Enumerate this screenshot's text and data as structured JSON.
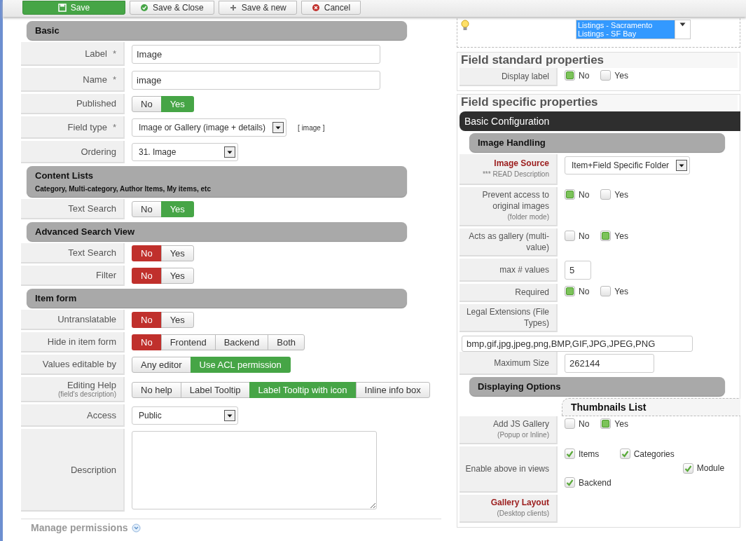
{
  "toolbar": {
    "buttons": [
      {
        "label": "Save",
        "kind": "save"
      },
      {
        "label": "Save & Close",
        "kind": "apply"
      },
      {
        "label": "Save & new",
        "kind": "new"
      },
      {
        "label": "Cancel",
        "kind": "cancel"
      }
    ]
  },
  "left": {
    "sections": [
      {
        "title": "Basic",
        "rows": [
          {
            "kind": "text",
            "label": "Label",
            "marker": "*",
            "value": "Image"
          },
          {
            "kind": "text",
            "label": "Name",
            "marker": "*",
            "value": "image"
          },
          {
            "kind": "toggle",
            "label": "Published",
            "negative": false,
            "options": [
              {
                "label": "No",
                "selected": false
              },
              {
                "label": "Yes",
                "selected": true
              }
            ]
          },
          {
            "kind": "select",
            "label": "Field type",
            "marker": "*",
            "value": "Image or Gallery (image + details)",
            "note": "[ image ]"
          },
          {
            "kind": "select",
            "label": "Ordering",
            "value": "31. Image"
          }
        ]
      },
      {
        "title": "Content Lists",
        "subtitle": "Category, Multi-category, Author Items, My items, etc",
        "rows": [
          {
            "kind": "toggle",
            "label": "Text Search",
            "negative": false,
            "options": [
              {
                "label": "No",
                "selected": false
              },
              {
                "label": "Yes",
                "selected": true
              }
            ]
          }
        ]
      },
      {
        "title": "Advanced Search View",
        "rows": [
          {
            "kind": "toggle",
            "label": "Text Search",
            "negative": true,
            "options": [
              {
                "label": "No",
                "selected": true
              },
              {
                "label": "Yes",
                "selected": false
              }
            ]
          },
          {
            "kind": "toggle",
            "label": "Filter",
            "negative": true,
            "options": [
              {
                "label": "No",
                "selected": true
              },
              {
                "label": "Yes",
                "selected": false
              }
            ]
          }
        ]
      },
      {
        "title": "Item form",
        "rows": [
          {
            "kind": "toggle",
            "label": "Untranslatable",
            "negative": true,
            "options": [
              {
                "label": "No",
                "selected": true
              },
              {
                "label": "Yes",
                "selected": false
              }
            ]
          },
          {
            "kind": "toggle",
            "label": "Hide in item form",
            "negative": true,
            "options": [
              {
                "label": "No",
                "selected": true
              },
              {
                "label": "Frontend",
                "selected": false
              },
              {
                "label": "Backend",
                "selected": false
              },
              {
                "label": "Both",
                "selected": false
              }
            ]
          },
          {
            "kind": "toggle",
            "label": "Values editable by",
            "negative": false,
            "options": [
              {
                "label": "Any editor",
                "selected": false
              },
              {
                "label": "Use ACL permission",
                "selected": true
              }
            ]
          },
          {
            "kind": "toggle",
            "label": "Editing Help",
            "sublabel": "(field's description)",
            "negative": false,
            "options": [
              {
                "label": "No help",
                "selected": false
              },
              {
                "label": "Label Tooltip",
                "selected": false
              },
              {
                "label": "Label Tooltip with icon",
                "selected": true
              },
              {
                "label": "Inline info box",
                "selected": false
              }
            ]
          },
          {
            "kind": "select",
            "label": "Access",
            "value": "Public"
          },
          {
            "kind": "textarea",
            "label": "Description"
          }
        ]
      }
    ],
    "footer": {
      "label": "Manage permissions"
    }
  },
  "right": {
    "listbox": {
      "items": [
        {
          "label": "Listings - Sacramento",
          "selected": true
        },
        {
          "label": "Listings - SF Bay",
          "selected": true
        }
      ]
    },
    "panels": [
      {
        "title": "Field standard properties",
        "rows": [
          {
            "kind": "radio",
            "label": "Display label",
            "options": [
              {
                "label": "No",
                "selected": true
              },
              {
                "label": "Yes",
                "selected": false
              }
            ]
          }
        ]
      },
      {
        "title": "Field specific properties",
        "tab": "Basic Configuration",
        "sections": [
          {
            "title": "Image Handling",
            "rows": [
              {
                "kind": "select",
                "label": "Image Source",
                "important": true,
                "sublabel": "*** READ Description",
                "value": "Item+Field Specific Folder"
              },
              {
                "kind": "radio",
                "label": "Prevent access to original images",
                "sublabel": "(folder mode)",
                "options": [
                  {
                    "label": "No",
                    "selected": true
                  },
                  {
                    "label": "Yes",
                    "selected": false
                  }
                ]
              },
              {
                "kind": "radio",
                "label": "Acts as gallery (multi-value)",
                "options": [
                  {
                    "label": "No",
                    "selected": false
                  },
                  {
                    "label": "Yes",
                    "selected": true
                  }
                ]
              },
              {
                "kind": "number",
                "label": "max # values",
                "value": "5"
              },
              {
                "kind": "radio",
                "label": "Required",
                "options": [
                  {
                    "label": "No",
                    "selected": true
                  },
                  {
                    "label": "Yes",
                    "selected": false
                  }
                ]
              },
              {
                "kind": "label",
                "label": "Legal Extensions (File Types)"
              },
              {
                "kind": "wide_text",
                "value": "bmp,gif,jpg,jpeg,png,BMP,GIF,JPG,JPEG,PNG"
              },
              {
                "kind": "text",
                "label": "Maximum Size",
                "value": "262144"
              }
            ]
          },
          {
            "title": "Displaying Options",
            "subtab": "Thumbnails List",
            "rows": [
              {
                "kind": "radio",
                "label": "Add JS Gallery",
                "sublabel": "(Popup or Inline)",
                "options": [
                  {
                    "label": "No",
                    "selected": false
                  },
                  {
                    "label": "Yes",
                    "selected": true
                  }
                ]
              },
              {
                "kind": "checks",
                "label": "Enable above in views",
                "options": [
                  {
                    "label": "Items",
                    "checked": true
                  },
                  {
                    "label": "Categories",
                    "checked": true
                  },
                  {
                    "label": "Module",
                    "checked": true
                  },
                  {
                    "label": "Backend",
                    "checked": true
                  }
                ]
              },
              {
                "kind": "label",
                "label": "Gallery Layout",
                "important": true,
                "sublabel": "(Desktop clients)"
              }
            ]
          }
        ]
      }
    ]
  }
}
